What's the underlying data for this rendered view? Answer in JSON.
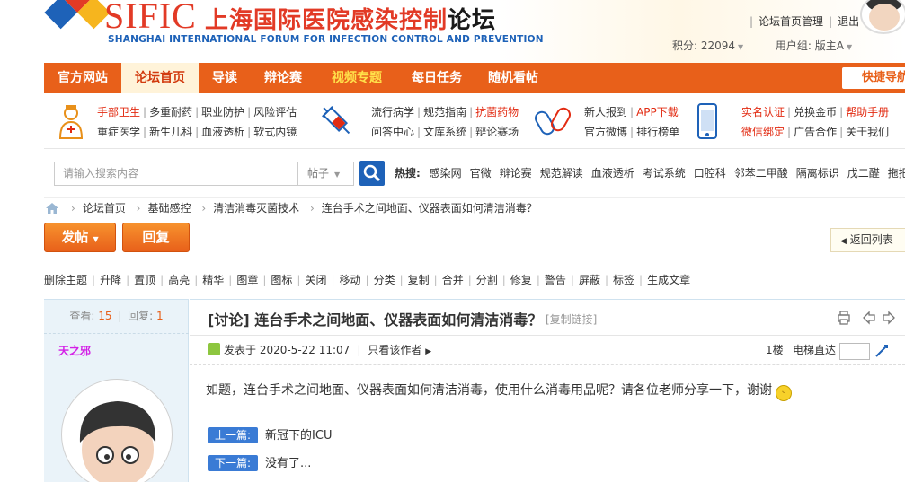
{
  "colors": {
    "brand_orange": "#e8601a",
    "brand_red": "#e23a26",
    "brand_blue": "#1e62b8",
    "highlight_red": "#e22b12",
    "author_magenta": "#d31ee6"
  },
  "header": {
    "logo_text": "SIFIC",
    "title_cn_main": "上海国际医院感染控制",
    "title_cn_suffix": "论坛",
    "title_en": "SHANGHAI INTERNATIONAL FORUM FOR INFECTION CONTROL AND PREVENTION",
    "user_links": [
      "论坛首页管理",
      "退出"
    ],
    "points_label": "积分: 22094",
    "group_label": "用户组: 版主A"
  },
  "nav": {
    "items": [
      "官方网站",
      "论坛首页",
      "导读",
      "辩论赛",
      "视频专题",
      "每日任务",
      "随机看帖"
    ],
    "active_index": 1,
    "quick_nav": "快捷导航"
  },
  "quick_links": {
    "group1": {
      "row1": [
        "手部卫生",
        "多重耐药",
        "职业防护",
        "风险评估"
      ],
      "row2": [
        "重症医学",
        "新生儿科",
        "血液透析",
        "软式内镜"
      ],
      "red_items": [
        "手部卫生"
      ]
    },
    "group2": {
      "row1": [
        "流行病学",
        "规范指南",
        "抗菌药物"
      ],
      "row2": [
        "问答中心",
        "文库系统",
        "辩论赛场"
      ],
      "red_items": [
        "抗菌药物"
      ]
    },
    "group3": {
      "row1": [
        "新人报到",
        "APP下载"
      ],
      "row2": [
        "官方微博",
        "排行榜单"
      ],
      "red_items": [
        "APP下载"
      ]
    },
    "group4": {
      "row1": [
        "实名认证",
        "兑换金币",
        "帮助手册"
      ],
      "row2": [
        "微信绑定",
        "广告合作",
        "关于我们"
      ],
      "red_items": [
        "实名认证",
        "帮助手册",
        "微信绑定"
      ]
    }
  },
  "search": {
    "placeholder": "请输入搜索内容",
    "scope": "帖子",
    "hot_label": "热搜:",
    "hot_words": [
      "感染网",
      "官微",
      "辩论赛",
      "规范解读",
      "血液透析",
      "考试系统",
      "口腔科",
      "邻苯二甲酸",
      "隔离标识",
      "戊二醛",
      "拖把"
    ]
  },
  "breadcrumb": [
    "论坛首页",
    "基础感控",
    "清洁消毒灭菌技术",
    "连台手术之间地面、仪器表面如何清洁消毒？"
  ],
  "actions": {
    "post_label": "发帖",
    "reply_label": "回复",
    "back_label": "返回列表"
  },
  "mod_toolbar": [
    "删除主题",
    "升降",
    "置顶",
    "高亮",
    "精华",
    "图章",
    "图标",
    "关闭",
    "移动",
    "分类",
    "复制",
    "合并",
    "分割",
    "修复",
    "警告",
    "屏蔽",
    "标签",
    "生成文章"
  ],
  "thread": {
    "views_label": "查看:",
    "views": "15",
    "replies_label": "回复:",
    "replies": "1",
    "author": "天之邪",
    "title": "[讨论] 连台手术之间地面、仪器表面如何清洁消毒？",
    "copy_link": "[复制链接]",
    "posted": "发表于 2020-5-22 11:07",
    "only_author": "只看该作者",
    "floor": "1楼",
    "elevator": "电梯直达",
    "content": "如题，连台手术之间地面、仪器表面如何清洁消毒，使用什么消毒用品呢？请各位老师分享一下，谢谢",
    "prev_label": "上一篇:",
    "prev_title": "新冠下的ICU",
    "next_label": "下一篇:",
    "next_title": "没有了..."
  }
}
